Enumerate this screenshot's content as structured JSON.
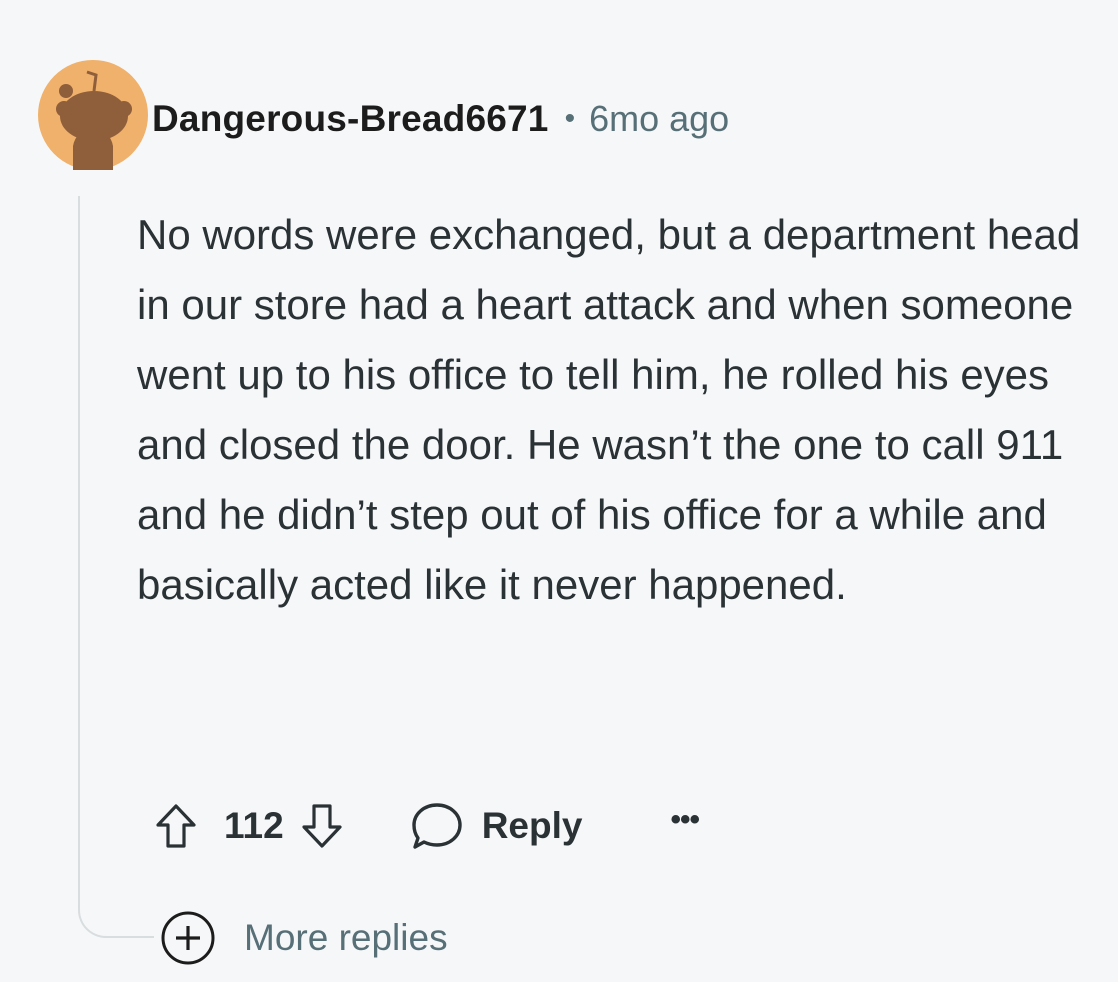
{
  "comment": {
    "author": "Dangerous-Bread6671",
    "separator": "•",
    "timestamp": "6mo ago",
    "body": "No words were exchanged, but a department head in our store had a heart attack and when someone went up to his office to tell him, he rolled his eyes and closed the door. He wasn’t the one to call 911 and he didn’t step out of his office for a while and basically acted like it never happened.",
    "score": "112",
    "reply_label": "Reply",
    "overflow_label": "•••"
  },
  "more_replies": {
    "label": "More replies"
  },
  "icons": {
    "avatar": "snoo-avatar-icon",
    "upvote": "upvote-arrow-icon",
    "downvote": "downvote-arrow-icon",
    "reply": "speech-bubble-icon",
    "overflow": "ellipsis-icon",
    "expand": "plus-circle-icon"
  },
  "colors": {
    "background": "#f6f7f9",
    "avatar_bg": "#efb16b",
    "avatar_figure": "#8f5e3b",
    "text_primary": "#2a3236",
    "text_secondary": "#576f76",
    "thread_line": "#d8dde0"
  }
}
